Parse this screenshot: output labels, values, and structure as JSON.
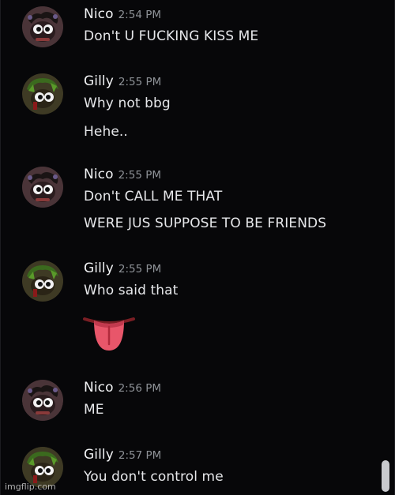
{
  "messages": [
    {
      "user": "Nico",
      "time": "2:54 PM",
      "lines": [
        "Don't U FUCKING KISS ME"
      ],
      "avatar_icon": "nico-avatar-icon"
    },
    {
      "user": "Gilly",
      "time": "2:55 PM",
      "lines": [
        "Why not bbg",
        "Hehe.."
      ],
      "avatar_icon": "gilly-avatar-icon"
    },
    {
      "user": "Nico",
      "time": "2:55 PM",
      "lines": [
        "Don't CALL ME THAT",
        "WERE JUS SUPPOSE TO BE FRIENDS"
      ],
      "avatar_icon": "nico-avatar-icon"
    },
    {
      "user": "Gilly",
      "time": "2:55 PM",
      "lines": [
        "Who said that"
      ],
      "emoji": "tongue-emoji",
      "avatar_icon": "gilly-avatar-icon"
    },
    {
      "user": "Nico",
      "time": "2:56 PM",
      "lines": [
        "ME"
      ],
      "avatar_icon": "nico-avatar-icon"
    },
    {
      "user": "Gilly",
      "time": "2:57 PM",
      "lines": [
        "You don't control me"
      ],
      "avatar_icon": "gilly-avatar-icon"
    }
  ],
  "watermark": "imgflip.com",
  "colors": {
    "background": "#070709",
    "username": "#f2f3f5",
    "timestamp": "#8e9297",
    "message_text": "#e6e7ea",
    "tongue": "#e8566a"
  }
}
